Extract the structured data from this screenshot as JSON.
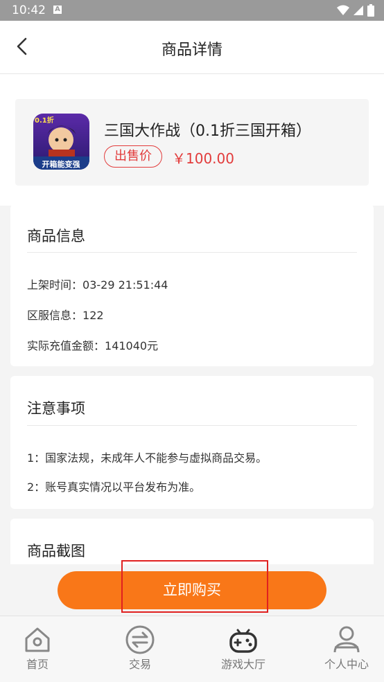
{
  "status_bar": {
    "time": "10:42",
    "notification_icon": "A"
  },
  "header": {
    "title": "商品详情",
    "back_icon": "back-arrow-icon"
  },
  "product": {
    "name": "三国大作战（0.1折三国开箱）",
    "price_tag": "出售价",
    "price": "￥100.00",
    "icon_badge": "0.1折",
    "icon_caption": "开箱能变强"
  },
  "goods_info": {
    "title": "商品信息",
    "rows": [
      {
        "label": "上架时间：",
        "value": "03-29 21:51:44"
      },
      {
        "label": "区服信息：",
        "value": "122"
      },
      {
        "label": "实际充值金额：",
        "value": "141040元"
      }
    ]
  },
  "notes": {
    "title": "注意事项",
    "items": [
      "1：国家法规，未成年人不能参与虚拟商品交易。",
      "2：账号真实情况以平台发布为准。"
    ]
  },
  "screenshots": {
    "title": "商品截图"
  },
  "buy_button": {
    "label": "立即购买"
  },
  "tabbar": {
    "tabs": [
      {
        "label": "首页",
        "icon": "home-icon"
      },
      {
        "label": "交易",
        "icon": "trade-icon"
      },
      {
        "label": "游戏大厅",
        "icon": "gamepad-icon"
      },
      {
        "label": "个人中心",
        "icon": "person-icon"
      }
    ]
  },
  "colors": {
    "accent": "#f97718",
    "price": "#e23b3b",
    "highlight": "#e02020"
  }
}
